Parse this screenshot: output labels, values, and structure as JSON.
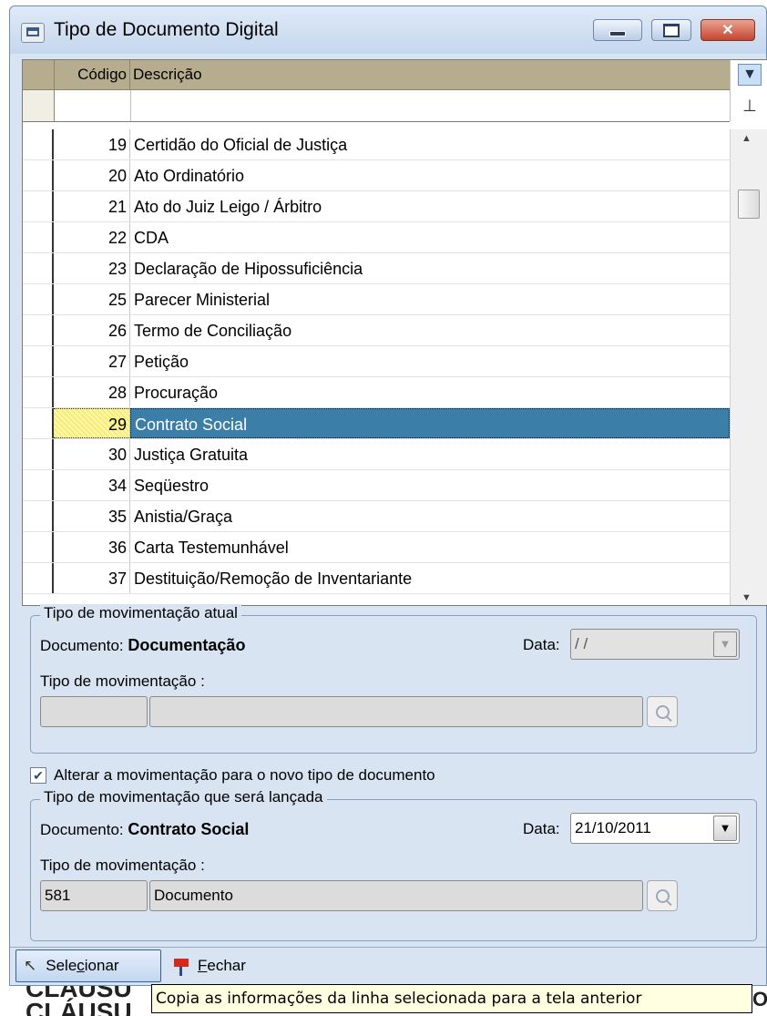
{
  "window": {
    "title": "Tipo de Documento Digital",
    "controls": {
      "minimize": "",
      "maximize": "",
      "close": "✕"
    }
  },
  "grid": {
    "columns": [
      "Código",
      "Descrição"
    ],
    "rows": [
      {
        "code": "19",
        "description": "Certidão do Oficial de Justiça"
      },
      {
        "code": "20",
        "description": "Ato Ordinatório"
      },
      {
        "code": "21",
        "description": "Ato do Juiz Leigo / Árbitro"
      },
      {
        "code": "22",
        "description": "CDA"
      },
      {
        "code": "23",
        "description": "Declaração de Hipossuficiência"
      },
      {
        "code": "25",
        "description": "Parecer Ministerial"
      },
      {
        "code": "26",
        "description": "Termo de Conciliação"
      },
      {
        "code": "27",
        "description": "Petição"
      },
      {
        "code": "28",
        "description": "Procuração"
      },
      {
        "code": "29",
        "description": "Contrato Social"
      },
      {
        "code": "30",
        "description": "Justiça Gratuita"
      },
      {
        "code": "34",
        "description": "Seqüestro"
      },
      {
        "code": "35",
        "description": "Anistia/Graça"
      },
      {
        "code": "36",
        "description": "Carta Testemunhável"
      },
      {
        "code": "37",
        "description": "Destituição/Remoção de Inventariante"
      }
    ],
    "selected_code": "29",
    "icons": {
      "filter": "filter-icon",
      "clear_filter": "clear-filter-icon"
    }
  },
  "current_movement": {
    "group_title": "Tipo de movimentação atual",
    "document_label": "Documento:",
    "document_value": "Documentação",
    "date_label": "Data:",
    "date_value": " / /",
    "movement_label": "Tipo de movimentação :",
    "movement_code": "",
    "movement_desc": ""
  },
  "change_checkbox": {
    "checked": true,
    "label": "Alterar a movimentação para o novo tipo de documento"
  },
  "new_movement": {
    "group_title": "Tipo de movimentação que será lançada",
    "document_label": "Documento:",
    "document_value": "Contrato Social",
    "date_label": "Data:",
    "date_value": "21/10/2011",
    "movement_label": "Tipo de movimentação :",
    "movement_code": "581",
    "movement_desc": "Documento"
  },
  "footer": {
    "select_pre": "Sele",
    "select_accel": "c",
    "select_post": "ionar",
    "close_accel": "F",
    "close_post": "echar"
  },
  "tooltip": "Copia as informações da linha selecionada para a tela anterior",
  "background_text": {
    "line1": "CLÁUSU",
    "line2": "CLÁUSU",
    "right": "O"
  },
  "colors": {
    "selection": "#3b7fa8",
    "header": "#b6ad8f",
    "window_bg": "#d8e4f2",
    "tooltip_bg": "#ffffe1"
  }
}
